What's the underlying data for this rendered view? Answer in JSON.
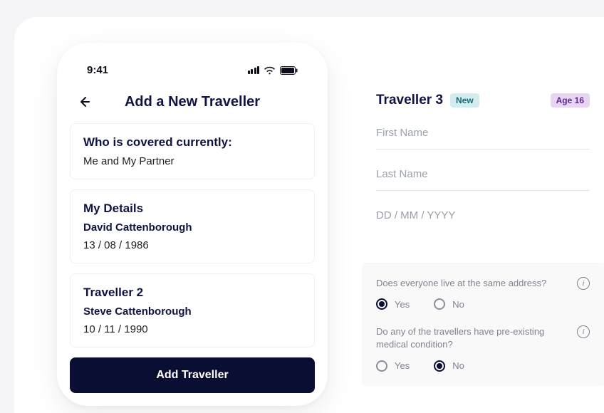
{
  "status_bar": {
    "time": "9:41"
  },
  "phone": {
    "title": "Add a New Traveller",
    "covered": {
      "heading": "Who is covered currently:",
      "value": "Me and My Partner"
    },
    "my_details": {
      "heading": "My Details",
      "name": "David Cattenborough",
      "dob": "13 / 08 / 1986"
    },
    "traveller2": {
      "heading": "Traveller 2",
      "name": "Steve Cattenborough",
      "dob": "10 / 11 / 1990"
    },
    "add_button": "Add Traveller"
  },
  "right": {
    "traveller3": {
      "title": "Traveller 3",
      "new_badge": "New",
      "age_badge": "Age 16",
      "first_name_placeholder": "First Name",
      "last_name_placeholder": "Last Name",
      "dob_placeholder": "DD / MM / YYYY"
    },
    "q1": {
      "text": "Does everyone live at the same address?",
      "yes": "Yes",
      "no": "No",
      "selected": "yes"
    },
    "q2": {
      "text": "Do any of the travellers have pre-existing medical condition?",
      "yes": "Yes",
      "no": "No",
      "selected": "no"
    }
  }
}
